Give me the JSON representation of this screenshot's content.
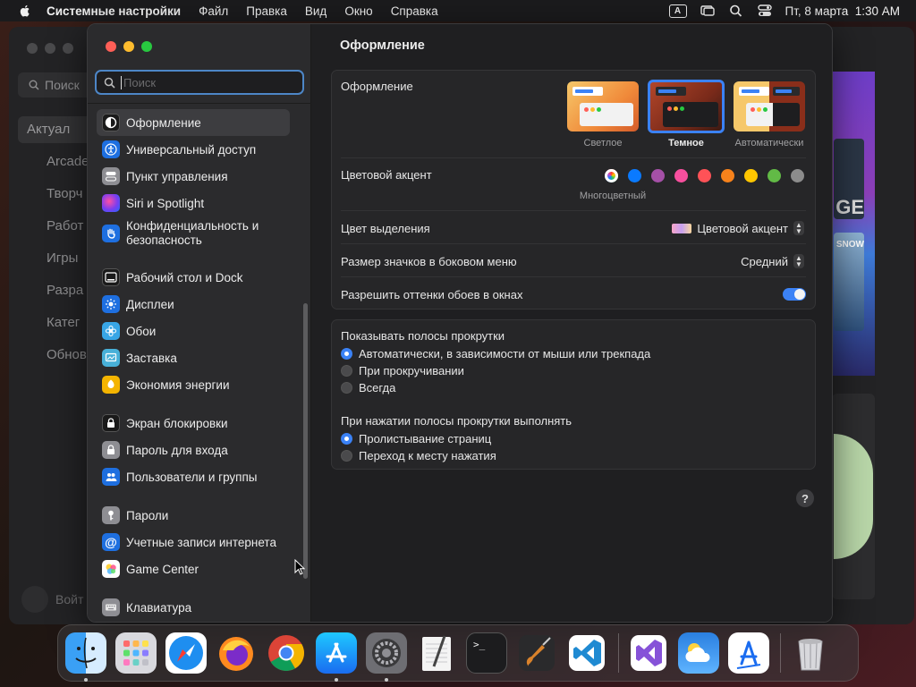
{
  "menubar": {
    "app": "Системные настройки",
    "items": [
      "Файл",
      "Правка",
      "Вид",
      "Окно",
      "Справка"
    ],
    "input_badge": "A",
    "clock": "Пт, 8 марта  1:30 AM"
  },
  "background_window": {
    "search": "Поиск",
    "nav": [
      "Актуал",
      "Arcade",
      "Творч",
      "Работ",
      "Игры",
      "Разра",
      "Катег",
      "Обнов"
    ],
    "bottom": "Войт",
    "game1_text": "GE",
    "game2_text": "SNOW"
  },
  "sidebar": {
    "search_placeholder": "Поиск",
    "groups": [
      [
        {
          "label": "Оформление",
          "icon": "appearance-icon",
          "color": "#1a1a1a",
          "selected": true
        },
        {
          "label": "Универсальный доступ",
          "icon": "accessibility-icon",
          "color": "#1e6fe0"
        },
        {
          "label": "Пункт управления",
          "icon": "control-center-icon",
          "color": "#8e8e93"
        },
        {
          "label": "Siri и Spotlight",
          "icon": "siri-icon",
          "color": "#c43cc8"
        },
        {
          "label": "Конфиденциальность и безопасность",
          "icon": "privacy-hand-icon",
          "color": "#1e6fe0"
        }
      ],
      [
        {
          "label": "Рабочий стол и Dock",
          "icon": "desktop-dock-icon",
          "color": "#1a1a1a"
        },
        {
          "label": "Дисплеи",
          "icon": "displays-icon",
          "color": "#1e6fe0"
        },
        {
          "label": "Обои",
          "icon": "wallpaper-icon",
          "color": "#38a6e6"
        },
        {
          "label": "Заставка",
          "icon": "screensaver-icon",
          "color": "#48b0d8"
        },
        {
          "label": "Экономия энергии",
          "icon": "energy-icon",
          "color": "#f4b400"
        }
      ],
      [
        {
          "label": "Экран блокировки",
          "icon": "lock-screen-icon",
          "color": "#1a1a1a"
        },
        {
          "label": "Пароль для входа",
          "icon": "login-password-icon",
          "color": "#8e8e93"
        },
        {
          "label": "Пользователи и группы",
          "icon": "users-icon",
          "color": "#1e6fe0"
        }
      ],
      [
        {
          "label": "Пароли",
          "icon": "passwords-key-icon",
          "color": "#8e8e93"
        },
        {
          "label": "Учетные записи интернета",
          "icon": "internet-accounts-icon",
          "color": "#1e6fe0"
        },
        {
          "label": "Game Center",
          "icon": "game-center-icon",
          "color": "#ffffff"
        }
      ],
      [
        {
          "label": "Клавиатура",
          "icon": "keyboard-icon",
          "color": "#8e8e93"
        }
      ]
    ]
  },
  "content": {
    "title": "Оформление",
    "appearance": {
      "label": "Оформление",
      "options": [
        {
          "label": "Светлое",
          "selected": false
        },
        {
          "label": "Темное",
          "selected": true
        },
        {
          "label": "Автоматически",
          "selected": false
        }
      ]
    },
    "accent": {
      "label": "Цветовой акцент",
      "selected_label": "Многоцветный",
      "colors": [
        "multicolor",
        "#0a7aff",
        "#a550a7",
        "#f74f9e",
        "#ff5257",
        "#f7821b",
        "#ffc600",
        "#62ba46",
        "#8c8c8c"
      ]
    },
    "highlight": {
      "label": "Цвет выделения",
      "value": "Цветовой акцент"
    },
    "sidebar_icon_size": {
      "label": "Размер значков в боковом меню",
      "value": "Средний"
    },
    "wallpaper_tinting": {
      "label": "Разрешить оттенки обоев в окнах",
      "enabled": true
    },
    "scrollbars": {
      "label": "Показывать полосы прокрутки",
      "options": [
        {
          "label": "Автоматически, в зависимости от мыши или трекпада",
          "selected": true
        },
        {
          "label": "При прокручивании",
          "selected": false
        },
        {
          "label": "Всегда",
          "selected": false
        }
      ]
    },
    "scroll_click": {
      "label": "При нажатии полосы прокрутки выполнять",
      "options": [
        {
          "label": "Пролистывание страниц",
          "selected": true
        },
        {
          "label": "Переход к месту нажатия",
          "selected": false
        }
      ]
    },
    "help": "?"
  },
  "dock": {
    "apps": [
      {
        "name": "finder-icon",
        "running": true
      },
      {
        "name": "launchpad-icon",
        "running": false
      },
      {
        "name": "safari-icon",
        "running": false
      },
      {
        "name": "firefox-icon",
        "running": false
      },
      {
        "name": "chrome-icon",
        "running": false
      },
      {
        "name": "app-store-icon",
        "running": true
      },
      {
        "name": "system-settings-icon",
        "running": true
      },
      {
        "name": "textedit-icon",
        "running": false
      },
      {
        "name": "terminal-icon",
        "running": false
      },
      {
        "name": "garageband-icon",
        "running": false
      },
      {
        "name": "vscode-icon",
        "running": false
      }
    ],
    "apps_right": [
      {
        "name": "visual-studio-icon",
        "running": false
      },
      {
        "name": "weather-icon",
        "running": false
      },
      {
        "name": "xcode-instruments-icon",
        "running": false
      }
    ],
    "trash": "trash-icon"
  }
}
